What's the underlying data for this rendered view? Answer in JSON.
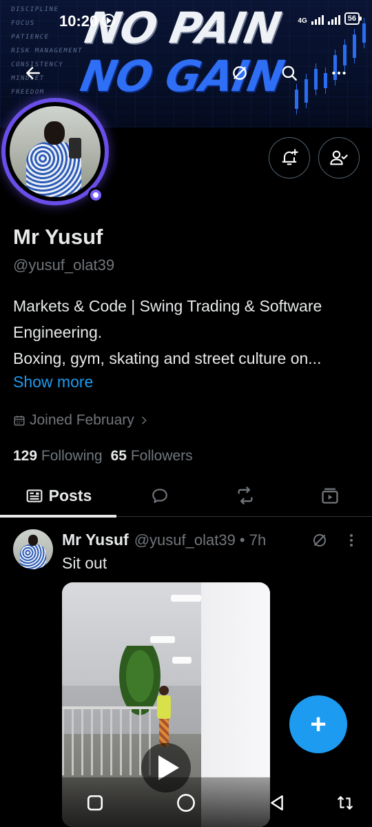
{
  "status_bar": {
    "time": "10:20",
    "network": "4G",
    "battery": "56"
  },
  "banner": {
    "line1": "NO PAIN",
    "line2": "NO GAIN",
    "words": [
      "DISCIPLINE",
      "FOCUS",
      "PATIENCE",
      "RISK MANAGEMENT",
      "CONSISTENCY",
      "MINDSET",
      "FREEDOM"
    ]
  },
  "profile": {
    "display_name": "Mr Yusuf",
    "handle": "@yusuf_olat39",
    "bio_lines": [
      "Markets & Code | Swing Trading & Software",
      "Engineering.",
      "Boxing, gym, skating and street culture on..."
    ],
    "show_more": "Show more",
    "joined": "Joined February",
    "following_count": "129",
    "following_label": "Following",
    "followers_count": "65",
    "followers_label": "Followers"
  },
  "tabs": {
    "posts_label": "Posts"
  },
  "post": {
    "author_name": "Mr Yusuf",
    "meta": "@yusuf_olat39 • 7h",
    "text": "Sit out"
  },
  "colors": {
    "accent": "#1d9bf0",
    "avatar_ring": "#6a4ee8",
    "secondary_text": "#71767b",
    "background": "#000000"
  },
  "icons": [
    "back-arrow-icon",
    "grok-icon",
    "search-icon",
    "more-icon",
    "notification-bell-icon",
    "following-person-icon",
    "calendar-icon",
    "chevron-right-icon",
    "posts-tab-icon",
    "replies-icon",
    "repost-icon",
    "media-icon",
    "play-icon",
    "plus-icon"
  ]
}
